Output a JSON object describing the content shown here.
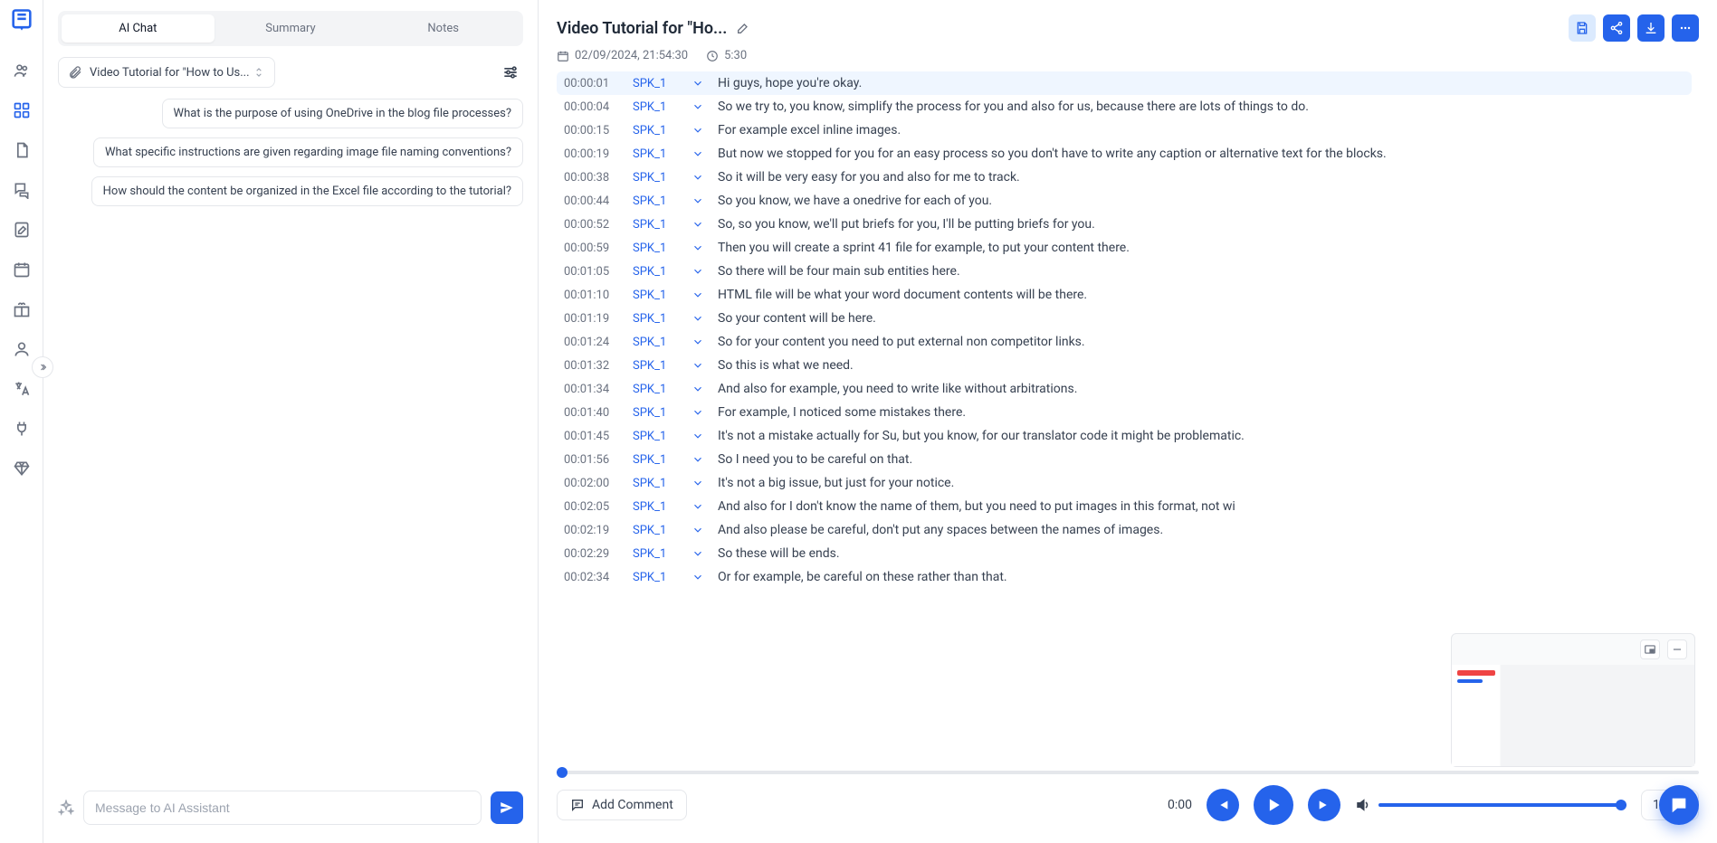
{
  "tabs": {
    "ai_chat": "AI Chat",
    "summary": "Summary",
    "notes": "Notes"
  },
  "file_select_label": "Video Tutorial for \"How to Us...",
  "suggestions": [
    "What is the purpose of using OneDrive in the blog file processes?",
    "What specific instructions are given regarding image file naming conventions?",
    "How should the content be organized in the Excel file according to the tutorial?"
  ],
  "chat_placeholder": "Message to AI Assistant",
  "header": {
    "title": "Video Tutorial for \"Ho...",
    "date": "02/09/2024, 21:54:30",
    "duration": "5:30"
  },
  "transcript": [
    {
      "t": "00:00:01",
      "s": "SPK_1",
      "txt": "Hi guys, hope you're okay.",
      "hl": true
    },
    {
      "t": "00:00:04",
      "s": "SPK_1",
      "txt": "So we try to, you know, simplify the process for you and also for us, because there are lots of things to do."
    },
    {
      "t": "00:00:15",
      "s": "SPK_1",
      "txt": "For example excel inline images."
    },
    {
      "t": "00:00:19",
      "s": "SPK_1",
      "txt": "But now we stopped for you for an easy process so you don't have to write any caption or alternative text for the blocks."
    },
    {
      "t": "00:00:38",
      "s": "SPK_1",
      "txt": "So it will be very easy for you and also for me to track."
    },
    {
      "t": "00:00:44",
      "s": "SPK_1",
      "txt": "So you know, we have a onedrive for each of you."
    },
    {
      "t": "00:00:52",
      "s": "SPK_1",
      "txt": "So, so you know, we'll put briefs for you, I'll be putting briefs for you."
    },
    {
      "t": "00:00:59",
      "s": "SPK_1",
      "txt": "Then you will create a sprint 41 file for example, to put your content there."
    },
    {
      "t": "00:01:05",
      "s": "SPK_1",
      "txt": "So there will be four main sub entities here."
    },
    {
      "t": "00:01:10",
      "s": "SPK_1",
      "txt": "HTML file will be what your word document contents will be there."
    },
    {
      "t": "00:01:19",
      "s": "SPK_1",
      "txt": "So your content will be here."
    },
    {
      "t": "00:01:24",
      "s": "SPK_1",
      "txt": "So for your content you need to put external non competitor links."
    },
    {
      "t": "00:01:32",
      "s": "SPK_1",
      "txt": "So this is what we need."
    },
    {
      "t": "00:01:34",
      "s": "SPK_1",
      "txt": "And also for example, you need to write like without arbitrations."
    },
    {
      "t": "00:01:40",
      "s": "SPK_1",
      "txt": "For example, I noticed some mistakes there."
    },
    {
      "t": "00:01:45",
      "s": "SPK_1",
      "txt": "It's not a mistake actually for Su, but you know, for our translator code it might be problematic."
    },
    {
      "t": "00:01:56",
      "s": "SPK_1",
      "txt": "So I need you to be careful on that."
    },
    {
      "t": "00:02:00",
      "s": "SPK_1",
      "txt": "It's not a big issue, but just for your notice."
    },
    {
      "t": "00:02:05",
      "s": "SPK_1",
      "txt": "And also for I don't know the name of them, but you need to put images in this format, not wi"
    },
    {
      "t": "00:02:19",
      "s": "SPK_1",
      "txt": "And also please be careful, don't put any spaces between the names of images."
    },
    {
      "t": "00:02:29",
      "s": "SPK_1",
      "txt": "So these will be ends."
    },
    {
      "t": "00:02:34",
      "s": "SPK_1",
      "txt": "Or for example, be careful on these rather than that."
    }
  ],
  "add_comment_label": "Add Comment",
  "player_time": "0:00",
  "speed_label": "1x"
}
